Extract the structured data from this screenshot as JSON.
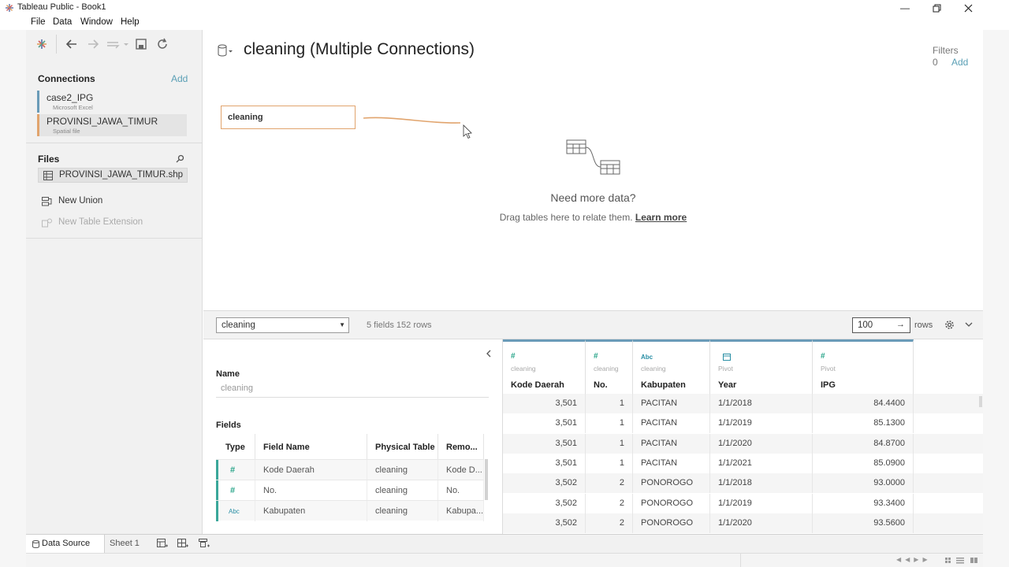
{
  "window": {
    "title": "Tableau Public - Book1"
  },
  "menu": [
    "File",
    "Data",
    "Window",
    "Help"
  ],
  "left_pane": {
    "connections_title": "Connections",
    "connections_add": "Add",
    "connections": [
      {
        "name": "case2_IPG",
        "type": "Microsoft Excel",
        "color": "#6a9bb8"
      },
      {
        "name": "PROVINSI_JAWA_TIMUR",
        "type": "Spatial file",
        "color": "#e1a46d"
      }
    ],
    "files_title": "Files",
    "files": [
      "PROVINSI_JAWA_TIMUR.shp"
    ],
    "options": [
      {
        "label": "New Union",
        "enabled": true
      },
      {
        "label": "New Table Extension",
        "enabled": false
      }
    ]
  },
  "canvas": {
    "datasource_title": "cleaning (Multiple Connections)",
    "filters_label": "Filters",
    "filters_count": "0",
    "filters_add": "Add",
    "table_box": "cleaning",
    "empty_title": "Need more data?",
    "empty_text": "Drag tables here to relate them.",
    "learn_more": "Learn more"
  },
  "lower_bar": {
    "table_select": "cleaning",
    "summary": "5 fields 152 rows",
    "rows_value": "100",
    "rows_label": "rows"
  },
  "meta": {
    "name_label": "Name",
    "name_value": "cleaning",
    "fields_label": "Fields",
    "columns": [
      "Type",
      "Field Name",
      "Physical Table",
      "Remo..."
    ],
    "rows": [
      {
        "type": "#",
        "field": "Kode Daerah",
        "table": "cleaning",
        "remote": "Kode D..."
      },
      {
        "type": "#",
        "field": "No.",
        "table": "cleaning",
        "remote": "No."
      },
      {
        "type": "Abc",
        "field": "Kabupaten",
        "table": "cleaning",
        "remote": "Kabupa..."
      }
    ]
  },
  "grid": {
    "columns": [
      {
        "icon": "#",
        "source": "cleaning",
        "name": "Kode Daerah"
      },
      {
        "icon": "#",
        "source": "cleaning",
        "name": "No."
      },
      {
        "icon": "Abc",
        "source": "cleaning",
        "name": "Kabupaten"
      },
      {
        "icon": "calendar",
        "source": "Pivot",
        "name": "Year"
      },
      {
        "icon": "#",
        "source": "Pivot",
        "name": "IPG"
      }
    ],
    "rows": [
      [
        "3,501",
        "1",
        "PACITAN",
        "1/1/2018",
        "84.4400"
      ],
      [
        "3,501",
        "1",
        "PACITAN",
        "1/1/2019",
        "85.1300"
      ],
      [
        "3,501",
        "1",
        "PACITAN",
        "1/1/2020",
        "84.8700"
      ],
      [
        "3,501",
        "1",
        "PACITAN",
        "1/1/2021",
        "85.0900"
      ],
      [
        "3,502",
        "2",
        "PONOROGO",
        "1/1/2018",
        "93.0000"
      ],
      [
        "3,502",
        "2",
        "PONOROGO",
        "1/1/2019",
        "93.3400"
      ],
      [
        "3,502",
        "2",
        "PONOROGO",
        "1/1/2020",
        "93.5600"
      ]
    ]
  },
  "tabs": {
    "data_source": "Data Source",
    "sheet1": "Sheet 1"
  }
}
